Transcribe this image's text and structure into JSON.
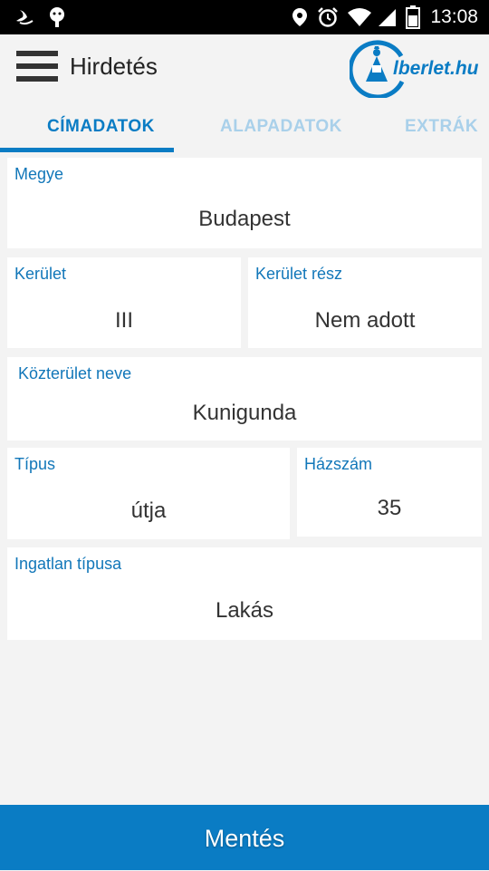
{
  "status_bar": {
    "time": "13:08",
    "icons": [
      "bird-icon",
      "android-icon",
      "location-icon",
      "alarm-icon",
      "wifi-icon",
      "signal-icon",
      "battery-icon"
    ]
  },
  "app_bar": {
    "title": "Hirdetés",
    "logo_text": "lberlet.hu",
    "menu_icon": "hamburger-icon"
  },
  "tabs": [
    {
      "label": "CÍMADATOK",
      "active": true
    },
    {
      "label": "ALAPADATOK",
      "active": false
    },
    {
      "label": "EXTRÁK",
      "active": false
    }
  ],
  "fields": {
    "megye": {
      "label": "Megye",
      "value": "Budapest"
    },
    "kerulet": {
      "label": "Kerület",
      "value": "III"
    },
    "kerulet_resz": {
      "label": "Kerület rész",
      "value": "Nem adott"
    },
    "kozterulet_neve": {
      "label": "Közterület neve",
      "value": "Kunigunda"
    },
    "tipus": {
      "label": "Típus",
      "value": "útja"
    },
    "hazszam": {
      "label": "Házszám",
      "value": "35"
    },
    "ingatlan_tipusa": {
      "label": "Ingatlan típusa",
      "value": "Lakás"
    }
  },
  "save_button": {
    "label": "Mentés"
  },
  "colors": {
    "accent": "#0a7cc4",
    "inactive_tab": "#a9d0ea",
    "background": "#f3f3f3",
    "card": "#ffffff"
  }
}
